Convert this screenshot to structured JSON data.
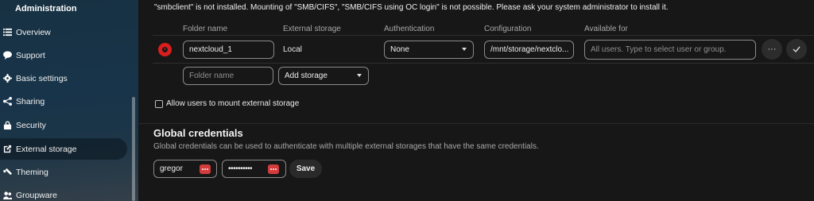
{
  "sidebar": {
    "section_title": "Administration",
    "items": [
      {
        "label": "Overview",
        "icon": "list-icon"
      },
      {
        "label": "Support",
        "icon": "speech-bubble-icon"
      },
      {
        "label": "Basic settings",
        "icon": "gear-icon"
      },
      {
        "label": "Sharing",
        "icon": "share-icon"
      },
      {
        "label": "Security",
        "icon": "lock-icon"
      },
      {
        "label": "External storage",
        "icon": "external-link-icon",
        "active": true
      },
      {
        "label": "Theming",
        "icon": "paintbrush-icon"
      },
      {
        "label": "Groupware",
        "icon": "group-icon"
      }
    ]
  },
  "warning": "\"smbclient\" is not installed. Mounting of \"SMB/CIFS\", \"SMB/CIFS using OC login\" is not possible. Please ask your system administrator to install it.",
  "table": {
    "headers": [
      "Folder name",
      "External storage",
      "Authentication",
      "Configuration",
      "Available for"
    ],
    "rows": [
      {
        "folder_name": "nextcloud_1",
        "external_storage": "Local",
        "authentication": "None",
        "configuration": "/mnt/storage/nextclo...",
        "available_for_placeholder": "All users. Type to select user or group."
      }
    ],
    "new_row": {
      "folder_name_placeholder": "Folder name",
      "add_storage_label": "Add storage"
    },
    "more_label": "···"
  },
  "allow_users_label": "Allow users to mount external storage",
  "global_credentials": {
    "title": "Global credentials",
    "description": "Global credentials can be used to authenticate with multiple external storages that have the same credentials.",
    "username": "gregor",
    "password_mask": "••••••••••",
    "save_label": "Save"
  },
  "colors": {
    "status_error": "#d81e1e",
    "password_manager": "#d33c3c"
  }
}
